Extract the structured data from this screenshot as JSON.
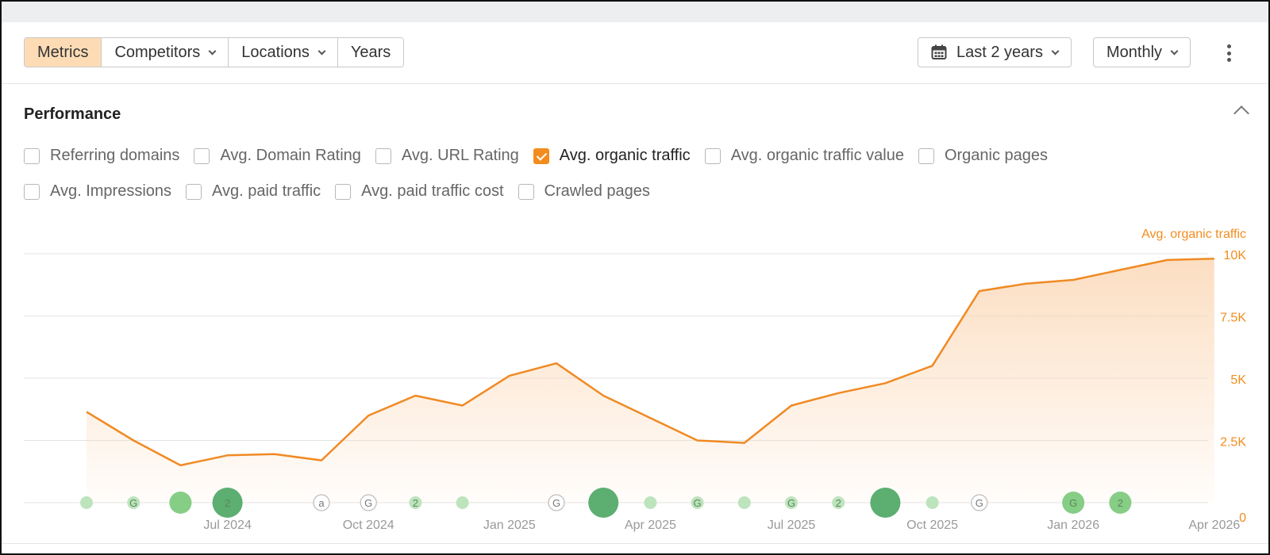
{
  "toolbar": {
    "tabs": [
      {
        "label": "Metrics",
        "active": true,
        "has_dropdown": false
      },
      {
        "label": "Competitors",
        "active": false,
        "has_dropdown": true
      },
      {
        "label": "Locations",
        "active": false,
        "has_dropdown": true
      },
      {
        "label": "Years",
        "active": false,
        "has_dropdown": false
      }
    ],
    "date_range_label": "Last 2 years",
    "date_range_icon": "calendar-icon",
    "interval_label": "Monthly",
    "more_icon": "more-vertical-icon"
  },
  "performance": {
    "title": "Performance",
    "collapse_icon": "chevron-up-icon",
    "checkbox_rows": [
      [
        {
          "label": "Referring domains",
          "checked": false
        },
        {
          "label": "Avg. Domain Rating",
          "checked": false
        },
        {
          "label": "Avg. URL Rating",
          "checked": false
        },
        {
          "label": "Avg. organic traffic",
          "checked": true
        },
        {
          "label": "Avg. organic traffic value",
          "checked": false
        },
        {
          "label": "Organic pages",
          "checked": false
        }
      ],
      [
        {
          "label": "Avg. Impressions",
          "checked": false
        },
        {
          "label": "Avg. paid traffic",
          "checked": false
        },
        {
          "label": "Avg. paid traffic cost",
          "checked": false
        },
        {
          "label": "Crawled pages",
          "checked": false
        }
      ]
    ]
  },
  "colors": {
    "accent": "#f28c1e",
    "series_line": "#f08a24",
    "area_fill": "#fbd3ad",
    "marker_light": "#b9e3b9",
    "marker_mid": "#79c879",
    "marker_dark": "#4aa562"
  },
  "chart_data": {
    "type": "area",
    "series": [
      {
        "name": "Avg. organic traffic",
        "x": [
          "2024-04",
          "2024-05",
          "2024-06",
          "2024-07",
          "2024-08",
          "2024-09",
          "2024-10",
          "2024-11",
          "2024-12",
          "2025-01",
          "2025-02",
          "2025-03",
          "2025-04",
          "2025-05",
          "2025-06",
          "2025-07",
          "2025-08",
          "2025-09",
          "2025-10",
          "2025-11",
          "2025-12",
          "2026-01",
          "2026-02",
          "2026-03",
          "2026-04"
        ],
        "values": [
          3650,
          2500,
          1500,
          1900,
          1950,
          1700,
          3500,
          4300,
          3900,
          5100,
          5600,
          4300,
          3400,
          2500,
          2400,
          3900,
          4400,
          4800,
          5500,
          8500,
          8800,
          8950,
          9350,
          9750,
          9800
        ]
      }
    ],
    "ylim": [
      0,
      10000
    ],
    "y_ticks": [
      0,
      2500,
      5000,
      7500,
      10000
    ],
    "y_tick_labels": [
      "0",
      "2.5K",
      "5K",
      "7.5K",
      "10K"
    ],
    "y_axis_position": "right",
    "y_axis_title": "Avg. organic traffic",
    "x_ticks": [
      "Jul 2024",
      "Oct 2024",
      "Jan 2025",
      "Apr 2025",
      "Jul 2025",
      "Oct 2025",
      "Jan 2026",
      "Apr 2026"
    ],
    "x_tick_months": [
      "2024-07",
      "2024-10",
      "2025-01",
      "2025-04",
      "2025-07",
      "2025-10",
      "2026-01",
      "2026-04"
    ],
    "grid": true,
    "legend": "none",
    "annotations": [
      {
        "month": "2024-04",
        "label": "",
        "size": "small",
        "tone": "light"
      },
      {
        "month": "2024-05",
        "label": "G",
        "size": "small",
        "tone": "light"
      },
      {
        "month": "2024-06",
        "label": "",
        "size": "medium",
        "tone": "mid"
      },
      {
        "month": "2024-07",
        "label": "2",
        "size": "large",
        "tone": "dark"
      },
      {
        "month": "2024-09",
        "label": "a",
        "size": "small",
        "tone": "outline"
      },
      {
        "month": "2024-10",
        "label": "G",
        "size": "small",
        "tone": "outline"
      },
      {
        "month": "2024-11",
        "label": "2",
        "size": "small",
        "tone": "light"
      },
      {
        "month": "2024-12",
        "label": "",
        "size": "small",
        "tone": "light"
      },
      {
        "month": "2025-02",
        "label": "G",
        "size": "small",
        "tone": "outline"
      },
      {
        "month": "2025-03",
        "label": "",
        "size": "large",
        "tone": "dark"
      },
      {
        "month": "2025-04",
        "label": "",
        "size": "small",
        "tone": "light"
      },
      {
        "month": "2025-05",
        "label": "G",
        "size": "small",
        "tone": "light"
      },
      {
        "month": "2025-06",
        "label": "",
        "size": "small",
        "tone": "light"
      },
      {
        "month": "2025-07",
        "label": "G",
        "size": "small",
        "tone": "light"
      },
      {
        "month": "2025-08",
        "label": "2",
        "size": "small",
        "tone": "light"
      },
      {
        "month": "2025-09",
        "label": "",
        "size": "large",
        "tone": "dark"
      },
      {
        "month": "2025-10",
        "label": "",
        "size": "small",
        "tone": "light"
      },
      {
        "month": "2025-11",
        "label": "G",
        "size": "small",
        "tone": "outline"
      },
      {
        "month": "2026-01",
        "label": "G",
        "size": "medium",
        "tone": "mid"
      },
      {
        "month": "2026-02",
        "label": "2",
        "size": "medium",
        "tone": "mid"
      }
    ]
  }
}
